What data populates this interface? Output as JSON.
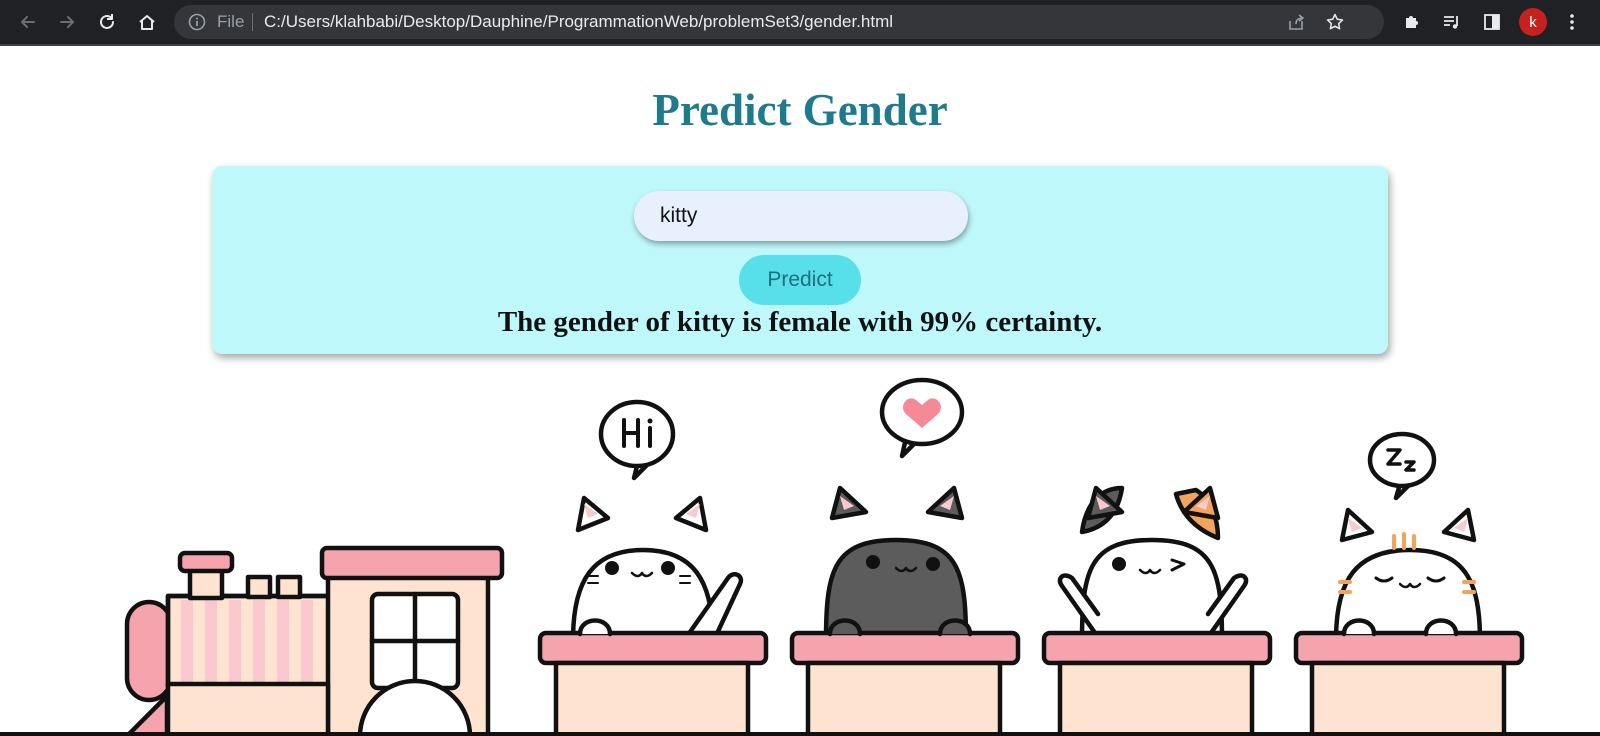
{
  "browser": {
    "file_label": "File",
    "url": "C:/Users/klahbabi/Desktop/Dauphine/ProgrammationWeb/problemSet3/gender.html",
    "avatar_letter": "k"
  },
  "page": {
    "title": "Predict Gender",
    "input": {
      "value": "kitty",
      "placeholder": ""
    },
    "predict_button": "Predict",
    "result": "The gender of kitty is female with 99% certainty."
  },
  "illustration": {
    "speech_bubbles": [
      "Hi",
      "heart",
      "Z",
      "z"
    ]
  },
  "colors": {
    "title": "#1f7a8c",
    "card": "#bff8fb",
    "button": "#58e0ea",
    "input": "#e8f0fe",
    "pink": "#f5a3ac",
    "peach": "#ffe3d1"
  }
}
